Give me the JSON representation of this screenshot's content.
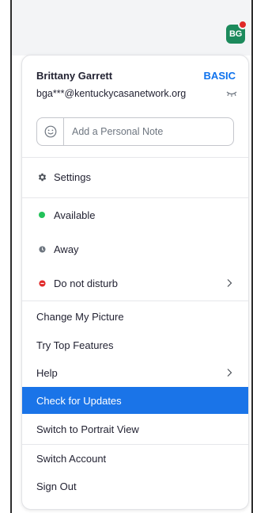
{
  "header": {
    "avatar_initials": "BG"
  },
  "profile": {
    "name": "Brittany Garrett",
    "plan": "BASIC",
    "email": "bga***@kentuckycasanetwork.org"
  },
  "note": {
    "placeholder": "Add a Personal Note"
  },
  "menu": {
    "settings": "Settings",
    "available": "Available",
    "away": "Away",
    "dnd": "Do not disturb",
    "change_picture": "Change My Picture",
    "top_features": "Try Top Features",
    "help": "Help",
    "check_updates": "Check for Updates",
    "portrait_view": "Switch to Portrait View",
    "switch_account": "Switch Account",
    "sign_out": "Sign Out"
  },
  "colors": {
    "accent": "#0e72ed",
    "highlight": "#1a74e8",
    "available": "#23c25a",
    "away": "#6e7680",
    "dnd": "#e02828",
    "avatar_bg": "#1c8a5c"
  },
  "icons": {
    "hide_email": "eye-closed-icon",
    "note_emoji": "smiley-icon",
    "settings": "gear-icon",
    "submenu": "chevron-right-icon"
  }
}
